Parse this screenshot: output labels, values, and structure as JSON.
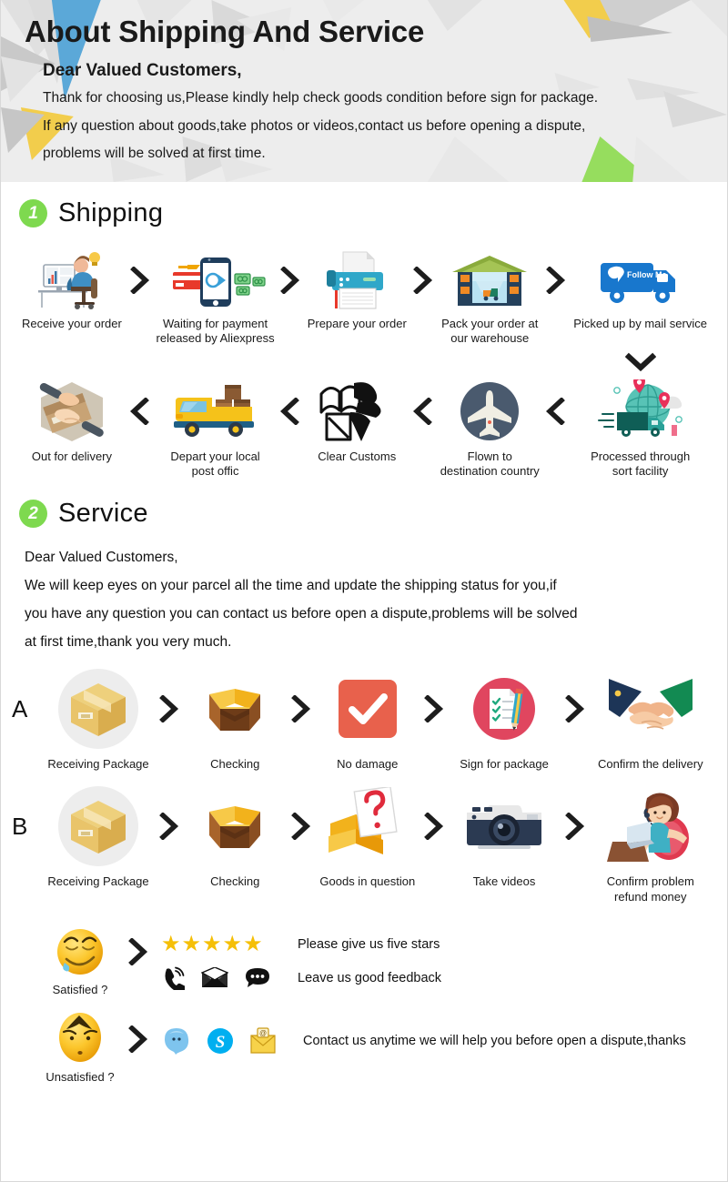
{
  "header": {
    "title": "About Shipping And Service",
    "salutation": "Dear Valued Customers,",
    "line1": "Thank for choosing us,Please kindly help check goods condition before sign for package.",
    "line2": "If any question about goods,take photos or videos,contact us before opening a dispute,",
    "line3": "problems will be solved at first time."
  },
  "shipping": {
    "badge": "1",
    "title": "Shipping",
    "row1": [
      {
        "label": "Receive your order",
        "icon": "desk-computer-user-icon"
      },
      {
        "label": "Waiting for payment\nreleased by Aliexpress",
        "icon": "mobile-payment-icon"
      },
      {
        "label": "Prepare your order",
        "icon": "printer-icon"
      },
      {
        "label": "Pack your order at\nour warehouse",
        "icon": "warehouse-icon"
      },
      {
        "label": "Picked up by mail service",
        "icon": "delivery-truck-follow-me-icon"
      }
    ],
    "row2": [
      {
        "label": "Out for delivery",
        "icon": "hands-package-icon"
      },
      {
        "label": "Depart your local\npost offic",
        "icon": "yellow-truck-boxes-icon"
      },
      {
        "label": "Clear Customs",
        "icon": "customs-officer-icon"
      },
      {
        "label": "Flown to\ndestination country",
        "icon": "airplane-circle-icon"
      },
      {
        "label": "Processed through\nsort facility",
        "icon": "globe-truck-pins-icon"
      }
    ]
  },
  "service": {
    "badge": "2",
    "title": "Service",
    "salutation": "Dear Valued Customers,",
    "para1": "We will keep eyes on your parcel all the time and update the shipping status for you,if",
    "para2": "you have any question you can contact us before open a dispute,problems will be solved",
    "para3": "at first time,thank you very much.",
    "rowA": {
      "letter": "A",
      "steps": [
        {
          "label": "Receiving Package",
          "icon": "closed-box-icon"
        },
        {
          "label": "Checking",
          "icon": "open-box-icon"
        },
        {
          "label": "No damage",
          "icon": "red-check-icon"
        },
        {
          "label": "Sign for package",
          "icon": "signed-document-icon"
        },
        {
          "label": "Confirm the delivery",
          "icon": "handshake-icon"
        }
      ]
    },
    "rowB": {
      "letter": "B",
      "steps": [
        {
          "label": "Receiving Package",
          "icon": "closed-box-icon"
        },
        {
          "label": "Checking",
          "icon": "open-box-icon"
        },
        {
          "label": "Goods in question",
          "icon": "question-box-icon"
        },
        {
          "label": "Take videos",
          "icon": "camera-icon"
        },
        {
          "label": "Confirm problem\nrefund money",
          "icon": "support-agent-icon"
        }
      ]
    }
  },
  "feedback": {
    "satisfied": {
      "label": "Satisfied ?",
      "icon": "relieved-emoji-icon",
      "stars": "★★★★★",
      "stars_text": "Please give us five stars",
      "contact_text": "Leave us good feedback",
      "contact_icons": [
        "phone-ring-icon",
        "mail-open-icon",
        "speech-bubble-icon"
      ]
    },
    "unsatisfied": {
      "label": "Unsatisfied ?",
      "icon": "worried-emoji-icon",
      "contact_icons": [
        "messenger-icon",
        "skype-icon",
        "email-envelope-icon"
      ],
      "text": "Contact us anytime we will help you before open a dispute,thanks"
    }
  },
  "colors": {
    "accent_green": "#7ed94f",
    "star_yellow": "#f5bf07",
    "header_bg": "#ededed"
  }
}
